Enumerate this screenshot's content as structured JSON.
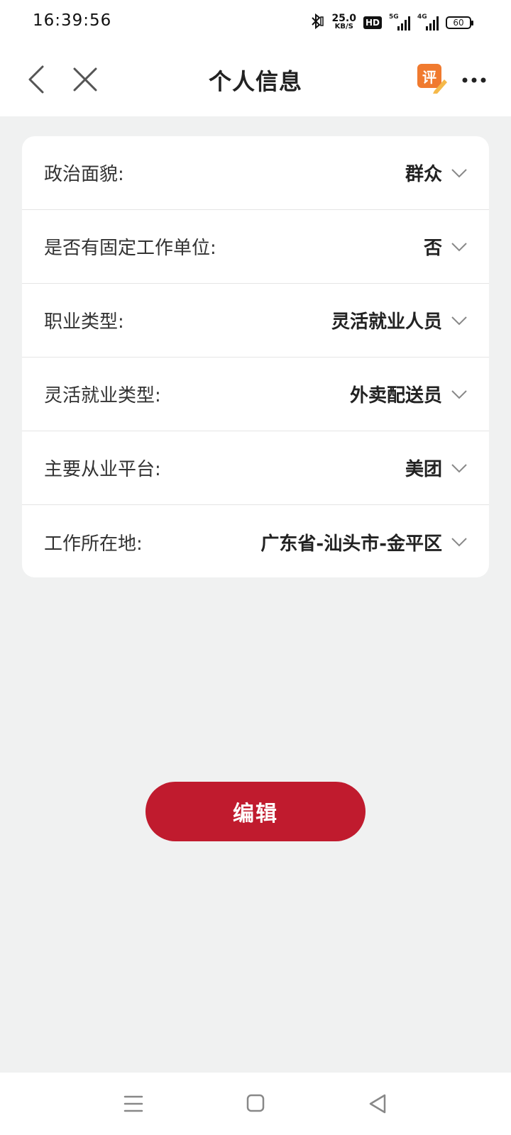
{
  "status_bar": {
    "time": "16:39:56",
    "net_speed_value": "25.0",
    "net_speed_unit": "KB/S",
    "hd_label": "HD",
    "signal_1_label": "5G",
    "signal_2_label": "4G",
    "battery_level": "60",
    "icons": [
      "bluetooth-icon",
      "hd-icon",
      "signal-5g-icon",
      "signal-4g-icon",
      "battery-icon"
    ]
  },
  "nav": {
    "title": "个人信息",
    "review_label": "评",
    "icons": [
      "back-icon",
      "close-icon",
      "review-icon",
      "more-icon"
    ]
  },
  "form": {
    "rows": [
      {
        "label": "政治面貌:",
        "value": "群众"
      },
      {
        "label": "是否有固定工作单位:",
        "value": "否"
      },
      {
        "label": "职业类型:",
        "value": "灵活就业人员"
      },
      {
        "label": "灵活就业类型:",
        "value": "外卖配送员"
      },
      {
        "label": "主要从业平台:",
        "value": "美团"
      },
      {
        "label": "工作所在地:",
        "value": "广东省-汕头市-金平区"
      }
    ]
  },
  "actions": {
    "edit_label": "编辑"
  },
  "system_nav": {
    "icons": [
      "menu-icon",
      "home-icon",
      "back-triangle-icon"
    ]
  },
  "colors": {
    "accent": "#c01b2e",
    "page_background": "#f0f1f1",
    "card_background": "#ffffff",
    "review_badge": "#f07a2f"
  }
}
